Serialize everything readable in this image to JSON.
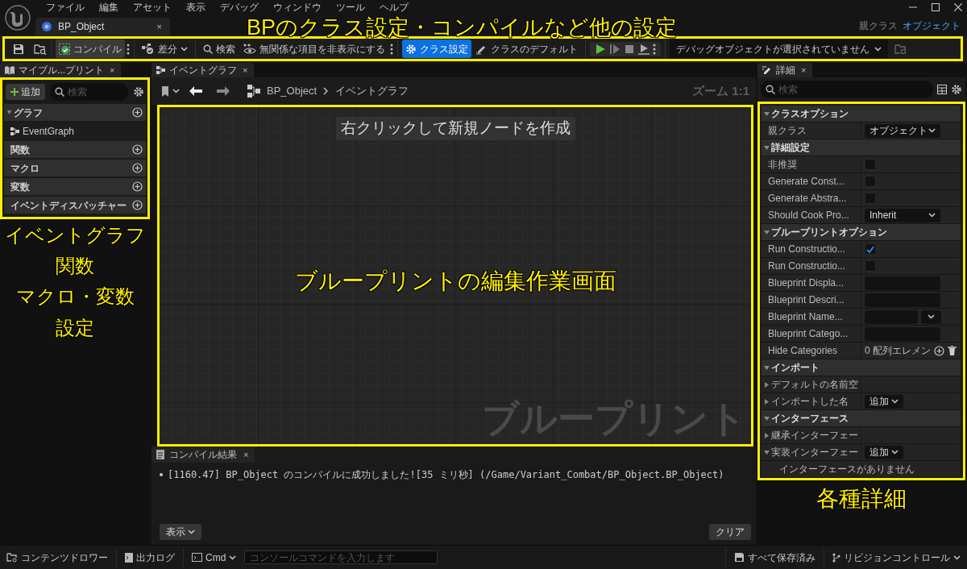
{
  "menu": [
    "ファイル",
    "編集",
    "アセット",
    "表示",
    "デバッグ",
    "ウィンドウ",
    "ツール",
    "ヘルプ"
  ],
  "document_tab": {
    "label": "BP_Object",
    "close": "×"
  },
  "parent_class": {
    "label": "親クラス",
    "value": "オブジェクト"
  },
  "toolbar_annotation": "BPのクラス設定・コンパイルなど他の設定",
  "toolbar": {
    "compile": "コンパイル",
    "diff": "差分",
    "search": "検索",
    "hide_unrelated": "無関係な項目を非表示にする",
    "mode_tabs": [
      {
        "label": "クラス設定",
        "selected": true
      },
      {
        "label": "クラスのデフォルト",
        "selected": false
      }
    ],
    "debug_object": "デバッグオブジェクトが選択されていません"
  },
  "my_blueprint": {
    "tab": "マイブル...プリント",
    "close": "×",
    "add_button": "追加",
    "search_placeholder": "検索",
    "sections": [
      {
        "label": "グラフ",
        "items": [
          "EventGraph"
        ]
      },
      {
        "label": "関数"
      },
      {
        "label": "マクロ"
      },
      {
        "label": "変数"
      },
      {
        "label": "イベントディスパッチャー"
      }
    ]
  },
  "my_blueprint_annotation": [
    "イベントグラフ",
    "関数",
    "マクロ・変数",
    "設定"
  ],
  "graph_tab": {
    "label": "イベントグラフ",
    "close": "×"
  },
  "breadcrumb": [
    "BP_Object",
    "イベントグラフ"
  ],
  "zoom": "ズーム 1:1",
  "graph_hint": "右クリックして新規ノードを作成",
  "graph_annotation": "ブループリントの編集作業画面",
  "graph_watermark": "ブループリント",
  "compiler_results": {
    "tab": "コンパイル結果",
    "close": "×",
    "messages": [
      "[1160.47] BP_Object のコンパイルに成功しました![35 ミリ秒] (/Game/Variant_Combat/BP_Object.BP_Object)"
    ],
    "view_button": "表示",
    "clear_button": "クリア"
  },
  "details": {
    "tab": "詳細",
    "close": "×",
    "search_placeholder": "検索",
    "rows": [
      {
        "kind": "category",
        "label": "クラスオプション",
        "expanded": true
      },
      {
        "kind": "dropdown",
        "label": "親クラス",
        "value": "オブジェクト"
      },
      {
        "kind": "category",
        "label": "詳細設定",
        "expanded": true
      },
      {
        "kind": "checkbox",
        "label": "非推奨",
        "checked": false
      },
      {
        "kind": "checkbox",
        "label": "Generate Const...",
        "checked": false
      },
      {
        "kind": "checkbox",
        "label": "Generate Abstra...",
        "checked": false
      },
      {
        "kind": "dropdown",
        "label": "Should Cook Pro...",
        "value": "Inherit"
      },
      {
        "kind": "category",
        "label": "ブループリントオプション",
        "expanded": true
      },
      {
        "kind": "checkbox",
        "label": "Run Constructio...",
        "checked": true
      },
      {
        "kind": "checkbox",
        "label": "Run Constructio...",
        "checked": false
      },
      {
        "kind": "text",
        "label": "Blueprint Displa..."
      },
      {
        "kind": "text",
        "label": "Blueprint Descri..."
      },
      {
        "kind": "combo",
        "label": "Blueprint Name..."
      },
      {
        "kind": "text",
        "label": "Blueprint Catego..."
      },
      {
        "kind": "array",
        "label": "Hide Categories",
        "value": "0 配列エレメン"
      },
      {
        "kind": "category",
        "label": "インポート",
        "expanded": true
      },
      {
        "kind": "group",
        "label": "デフォルトの名前空",
        "expanded": false
      },
      {
        "kind": "group",
        "label": "インポートした名",
        "expanded": false,
        "button": "追加"
      },
      {
        "kind": "category",
        "label": "インターフェース",
        "expanded": true
      },
      {
        "kind": "group",
        "label": "継承インターフェー",
        "expanded": false
      },
      {
        "kind": "group",
        "label": "実装インターフェー",
        "expanded": true,
        "button": "追加"
      },
      {
        "kind": "note",
        "label": "インターフェースがありません"
      }
    ]
  },
  "details_annotation": "各種詳細",
  "status_bar": {
    "content_drawer": "コンテンツドロワー",
    "output_log": "出力ログ",
    "cmd": "Cmd",
    "console_placeholder": "コンソールコマンドを入力します",
    "save_state": "すべて保存済み",
    "revision_control": "リビジョンコントロール"
  }
}
